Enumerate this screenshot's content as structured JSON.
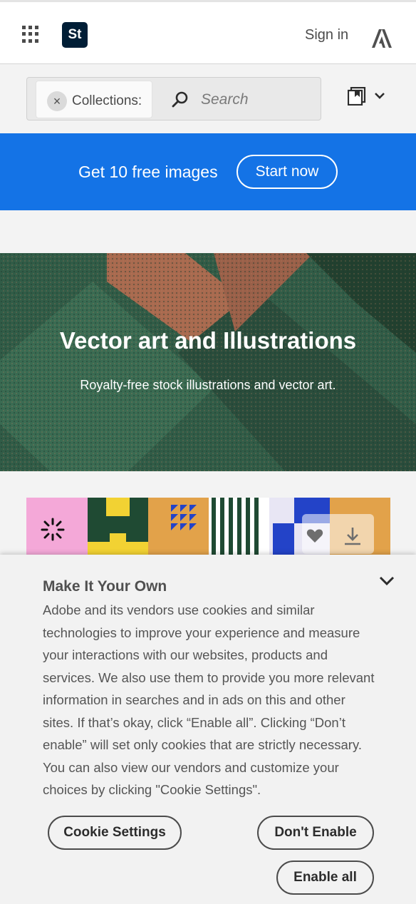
{
  "header": {
    "apps_icon": "apps-grid-icon",
    "logo_text": "St",
    "sign_in_label": "Sign in",
    "adobe_icon": "adobe-logo-icon"
  },
  "search": {
    "chip_label": "Collections:",
    "chip_close_glyph": "×",
    "placeholder": "Search",
    "value": "",
    "search_icon": "search-icon",
    "collections_icon": "collections-icon"
  },
  "promo": {
    "text": "Get 10 free images",
    "button_label": "Start now",
    "color": "#1473e6"
  },
  "hero": {
    "title": "Vector art and Illustrations",
    "subtitle": "Royalty-free stock illustrations and vector art."
  },
  "thumbnail": {
    "heart_icon": "heart-icon",
    "download_icon": "download-icon"
  },
  "cookie": {
    "title": "Make It Your Own",
    "body": "Adobe and its vendors use cookies and similar technologies to improve your experience and measure your interactions with our websites, products and services. We also use them to provide you more relevant information in searches and in ads on this and other sites. If that’s okay, click “Enable all”. Clicking “Don’t enable” will set only cookies that are strictly necessary. You can also view our vendors and customize your choices by clicking \"Cookie Settings\".",
    "settings_label": "Cookie Settings",
    "dont_enable_label": "Don't Enable",
    "enable_all_label": "Enable all"
  }
}
